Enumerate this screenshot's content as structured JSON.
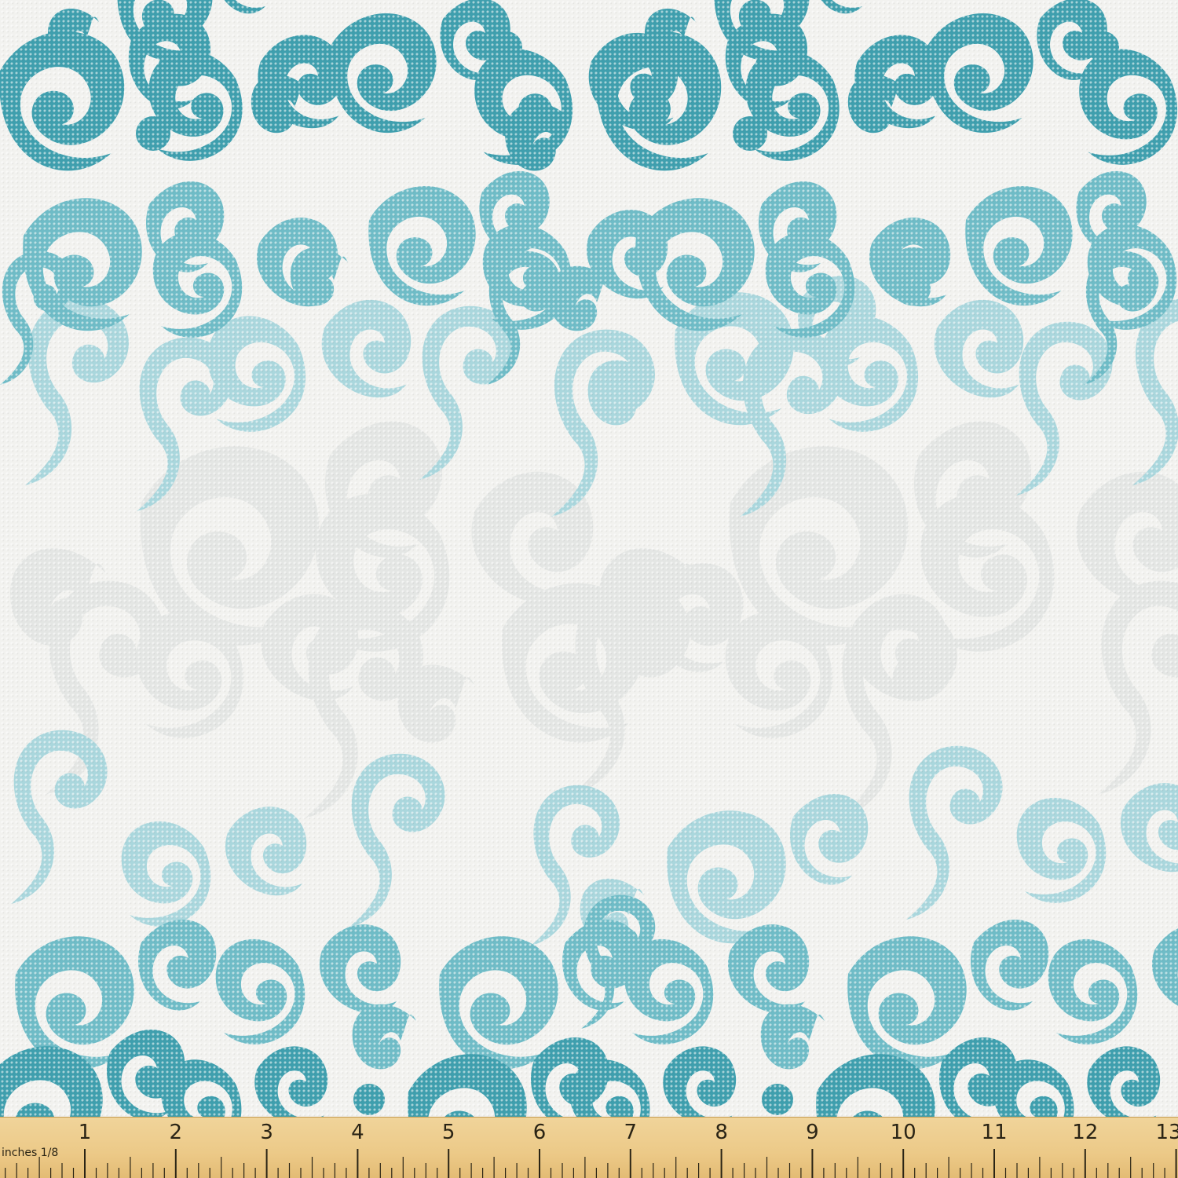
{
  "colors": {
    "background": "#f2f2ef",
    "teal_dark": "#3e9fae",
    "teal_mid": "#6cbac5",
    "teal_light": "#a6d6dc",
    "ghost_gray": "#e2e4e2",
    "ruler_wood": "#ecc987",
    "ruler_ink": "#2a2415"
  },
  "ruler": {
    "unit_label": "inches 1/8",
    "numbers": [
      "1",
      "2",
      "3",
      "4",
      "5",
      "6",
      "7",
      "8",
      "9",
      "10",
      "11",
      "12",
      "13"
    ]
  }
}
